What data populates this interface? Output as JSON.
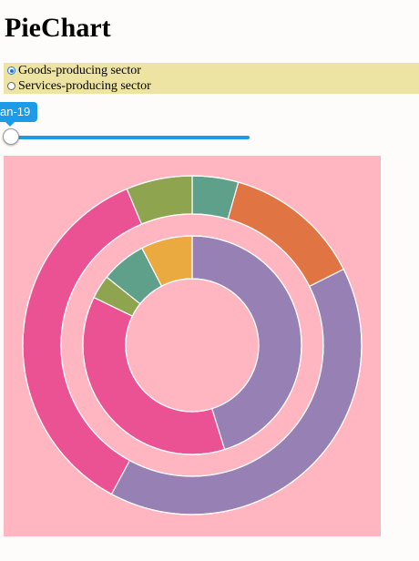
{
  "page": {
    "title": "PieChart"
  },
  "controls": {
    "options": [
      {
        "label": "Goods-producing sector",
        "selected": true
      },
      {
        "label": "Services-producing sector",
        "selected": false
      }
    ],
    "slider": {
      "label": "an-19",
      "value": 0
    }
  },
  "chart_data": {
    "type": "pie",
    "background": "#ffb6c1",
    "rings": [
      {
        "ring": "outer",
        "slices": [
          {
            "value": 4.4,
            "color": "#5fa08b"
          },
          {
            "value": 13.2,
            "color": "#e07442"
          },
          {
            "value": 40.3,
            "color": "#9780b3"
          },
          {
            "value": 35.8,
            "color": "#ea5294"
          },
          {
            "value": 6.3,
            "color": "#8fa44f"
          }
        ]
      },
      {
        "ring": "inner",
        "slices": [
          {
            "value": 45.2,
            "color": "#9780b3"
          },
          {
            "value": 37.0,
            "color": "#ea5294"
          },
          {
            "value": 3.5,
            "color": "#8fa44f"
          },
          {
            "value": 6.7,
            "color": "#5fa08b"
          },
          {
            "value": 7.6,
            "color": "#ebaa40"
          }
        ]
      }
    ]
  }
}
